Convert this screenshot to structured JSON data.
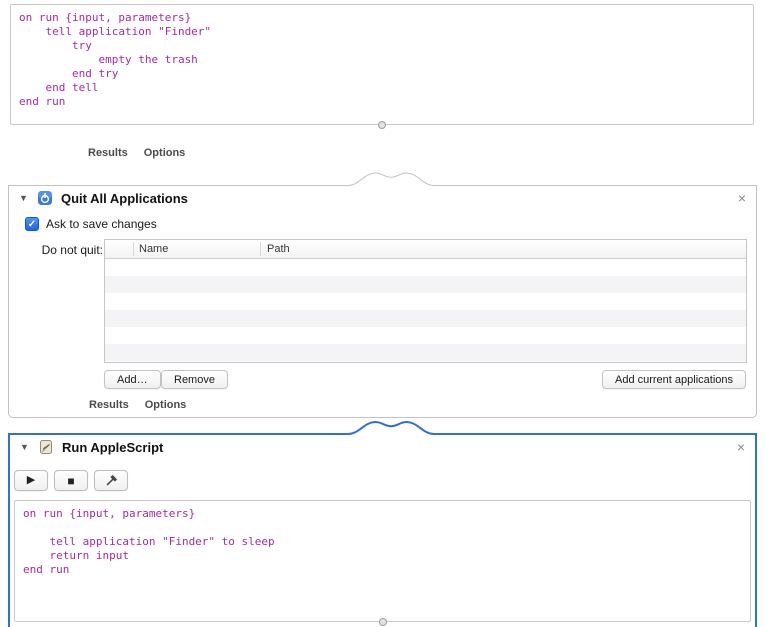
{
  "icons": {
    "disclosure": "▼",
    "close": "×",
    "check": "✓",
    "play": "▶",
    "stop": "■"
  },
  "colors": {
    "selection_blue": "#2e6fd9",
    "code_text": "#a62aa2"
  },
  "action1": {
    "code": [
      "on run {input, parameters}",
      "    tell application \"Finder\"",
      "        try",
      "            empty the trash",
      "        end try",
      "    end tell",
      "end run"
    ],
    "footer": {
      "results": "Results",
      "options": "Options"
    }
  },
  "action2": {
    "title": "Quit All Applications",
    "ask_to_save": {
      "label": "Ask to save changes",
      "checked": true
    },
    "do_not_quit_label": "Do not quit:",
    "table": {
      "columns": [
        "",
        "Name",
        "Path"
      ],
      "rows": []
    },
    "buttons": {
      "add": "Add…",
      "remove": "Remove",
      "add_current": "Add current applications"
    },
    "footer": {
      "results": "Results",
      "options": "Options"
    }
  },
  "action3": {
    "title": "Run AppleScript",
    "toolbar": {
      "run": "run",
      "stop": "stop",
      "compile": "compile"
    },
    "code": [
      "on run {input, parameters}",
      "    ",
      "    tell application \"Finder\" to sleep",
      "    return input",
      "end run"
    ]
  }
}
